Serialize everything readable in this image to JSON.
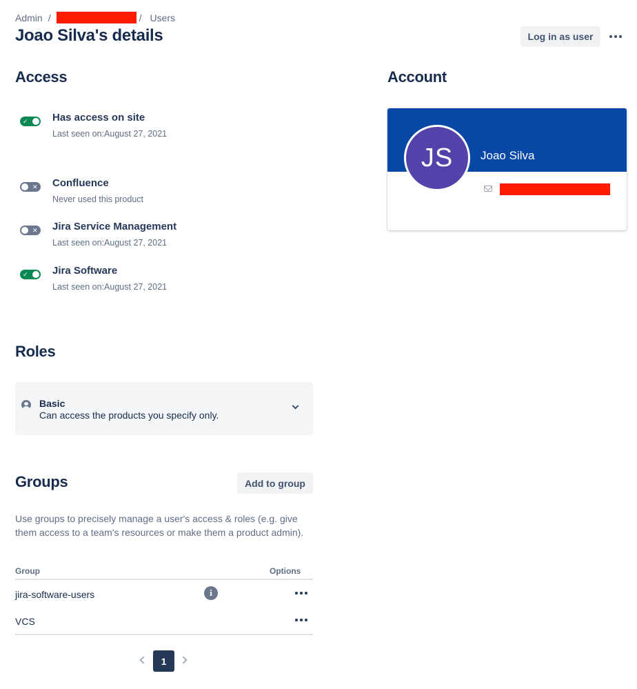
{
  "breadcrumb": {
    "admin": "Admin",
    "separator": "/",
    "users": "Users"
  },
  "page": {
    "title": "Joao Silva's details",
    "login_as_user": "Log in as user"
  },
  "access": {
    "heading": "Access",
    "items": [
      {
        "name": "Has access on site",
        "status": "Last seen on:August 27, 2021",
        "enabled": true
      },
      {
        "name": "Confluence",
        "status": "Never used this product",
        "enabled": false
      },
      {
        "name": "Jira Service Management",
        "status": "Last seen on:August 27, 2021",
        "enabled": false
      },
      {
        "name": "Jira Software",
        "status": "Last seen on:August 27, 2021",
        "enabled": true
      }
    ]
  },
  "account": {
    "heading": "Account",
    "initials": "JS",
    "name": "Joao Silva",
    "banner_color": "#0747a6",
    "avatar_color": "#5243aa"
  },
  "roles": {
    "heading": "Roles",
    "role_title": "Basic",
    "role_description": "Can access the products you specify only."
  },
  "groups": {
    "heading": "Groups",
    "add_button": "Add to group",
    "description": "Use groups to precisely manage a user's access & roles (e.g. give them access to a team's resources or make them a product admin).",
    "columns": {
      "group": "Group",
      "options": "Options"
    },
    "rows": [
      {
        "name": "jira-software-users"
      },
      {
        "name": "VCS"
      }
    ]
  },
  "pagination": {
    "current": "1"
  },
  "colors": {
    "toggle_on": "#0a8a52",
    "toggle_off": "#6b778c",
    "redaction": "#ff1a00"
  }
}
